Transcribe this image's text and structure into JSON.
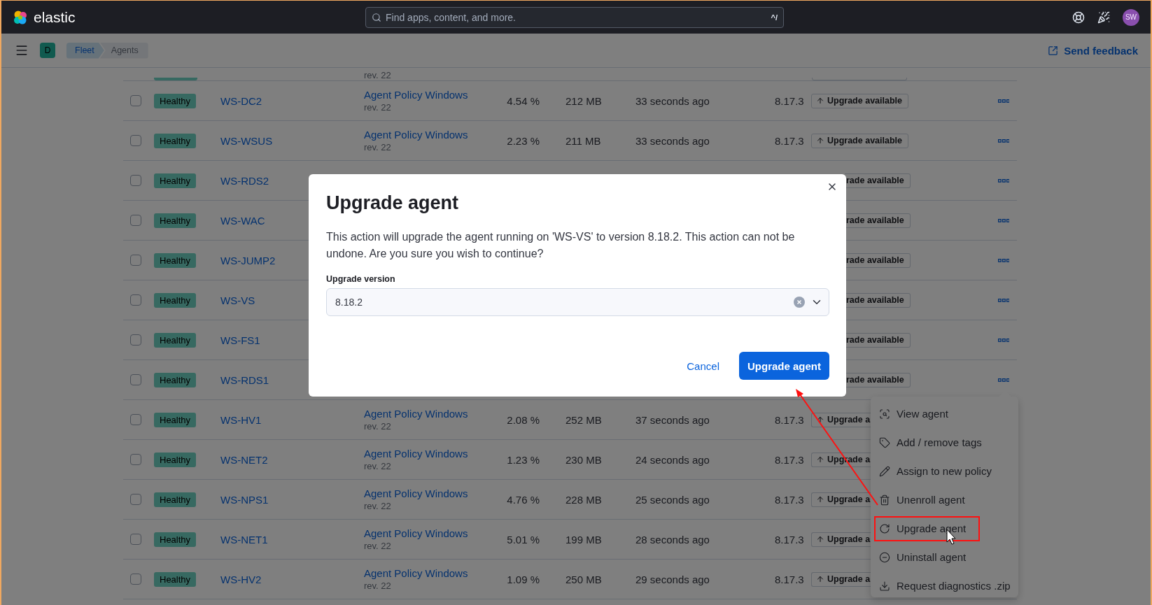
{
  "header": {
    "logo_text": "elastic",
    "search": {
      "placeholder": "Find apps, content, and more.",
      "shortcut": "^/"
    },
    "avatar": "SW"
  },
  "nav": {
    "space": "D",
    "breadcrumbs": [
      {
        "label": "Fleet",
        "selected": false
      },
      {
        "label": "Agents",
        "selected": true
      }
    ],
    "feedback": "Send feedback"
  },
  "agents_table": {
    "partial_row": {
      "rev": "rev. 22"
    },
    "rows": [
      {
        "kind": "full",
        "checked": false,
        "status": "Healthy",
        "name": "WS-DC2",
        "policy": "Agent Policy Windows",
        "rev": "rev. 22",
        "cpu": "4.54 %",
        "memory": "212 MB",
        "last_activity": "33 seconds ago",
        "version": "8.17.3",
        "upgrade": "Upgrade available"
      },
      {
        "kind": "full",
        "checked": false,
        "status": "Healthy",
        "name": "WS-WSUS",
        "policy": "Agent Policy Windows",
        "rev": "rev. 22",
        "cpu": "2.23 %",
        "memory": "211 MB",
        "last_activity": "33 seconds ago",
        "version": "8.17.3",
        "upgrade": "Upgrade available"
      },
      {
        "kind": "under_modal",
        "checked": false,
        "status": "Healthy",
        "name": "WS-RDS2",
        "upgrade": "rade available"
      },
      {
        "kind": "under_modal",
        "checked": false,
        "status": "Healthy",
        "name": "WS-WAC",
        "upgrade": "rade available"
      },
      {
        "kind": "under_modal",
        "checked": false,
        "status": "Healthy",
        "name": "WS-JUMP2",
        "upgrade": "rade available"
      },
      {
        "kind": "under_modal",
        "checked": false,
        "status": "Healthy",
        "name": "WS-VS",
        "upgrade": "rade available"
      },
      {
        "kind": "under_modal",
        "checked": false,
        "status": "Healthy",
        "name": "WS-FS1",
        "upgrade": "rade available"
      },
      {
        "kind": "under_modal",
        "checked": false,
        "status": "Healthy",
        "name": "WS-RDS1",
        "upgrade": "rade available"
      },
      {
        "kind": "under_menu",
        "checked": false,
        "status": "Healthy",
        "name": "WS-HV1",
        "policy": "Agent Policy Windows",
        "rev": "rev. 22",
        "cpu": "2.08 %",
        "memory": "252 MB",
        "last_activity": "37 seconds ago",
        "version": "8.17.3",
        "upgrade": "Upgrade a"
      },
      {
        "kind": "under_menu",
        "checked": false,
        "status": "Healthy",
        "name": "WS-NET2",
        "policy": "Agent Policy Windows",
        "rev": "rev. 22",
        "cpu": "1.23 %",
        "memory": "230 MB",
        "last_activity": "24 seconds ago",
        "version": "8.17.3",
        "upgrade": "Upgrade a"
      },
      {
        "kind": "under_menu",
        "checked": false,
        "status": "Healthy",
        "name": "WS-NPS1",
        "policy": "Agent Policy Windows",
        "rev": "rev. 22",
        "cpu": "4.76 %",
        "memory": "228 MB",
        "last_activity": "25 seconds ago",
        "version": "8.17.3",
        "upgrade": "Upgrade a"
      },
      {
        "kind": "under_menu",
        "checked": false,
        "status": "Healthy",
        "name": "WS-NET1",
        "policy": "Agent Policy Windows",
        "rev": "rev. 22",
        "cpu": "5.01 %",
        "memory": "199 MB",
        "last_activity": "28 seconds ago",
        "version": "8.17.3",
        "upgrade": "Upgrade a"
      },
      {
        "kind": "under_menu",
        "checked": false,
        "status": "Healthy",
        "name": "WS-HV2",
        "policy": "Agent Policy Windows",
        "rev": "rev. 22",
        "cpu": "1.09 %",
        "memory": "250 MB",
        "last_activity": "29 seconds ago",
        "version": "8.17.3",
        "upgrade": "Upgrade a"
      }
    ]
  },
  "actions_menu": {
    "items": [
      {
        "label": "View agent",
        "highlighted": false
      },
      {
        "label": "Add / remove tags",
        "highlighted": false
      },
      {
        "label": "Assign to new policy",
        "highlighted": false
      },
      {
        "label": "Unenroll agent",
        "highlighted": false
      },
      {
        "label": "Upgrade agent",
        "highlighted": true
      },
      {
        "label": "Uninstall agent",
        "highlighted": false
      },
      {
        "label": "Request diagnostics .zip",
        "highlighted": false
      }
    ]
  },
  "modal": {
    "title": "Upgrade agent",
    "body": "This action will upgrade the agent running on 'WS-VS' to version 8.18.2. This action can not be undone. Are you sure you wish to continue?",
    "field_label": "Upgrade version",
    "field_value": "8.18.2",
    "cancel": "Cancel",
    "confirm": "Upgrade agent"
  }
}
